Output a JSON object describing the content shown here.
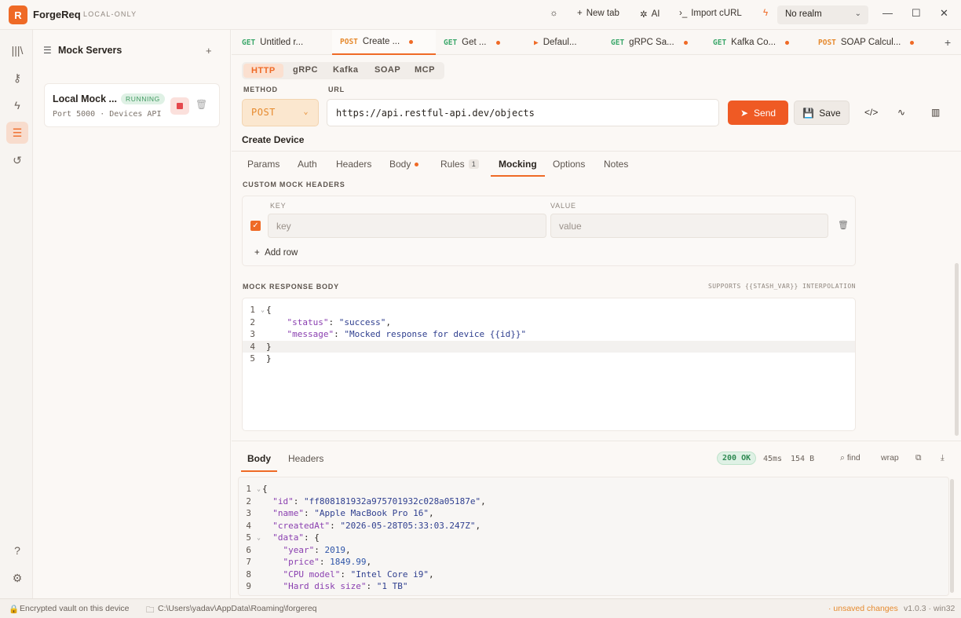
{
  "app": {
    "name": "ForgeReq",
    "badge": "LOCAL-ONLY",
    "logo_letter": "R"
  },
  "toolbar": {
    "theme_icon": "sun-icon",
    "new_tab": "New tab",
    "ai": "AI",
    "import_curl": "Import cURL",
    "realm": "No realm"
  },
  "rail": {
    "icons": [
      "library-icon",
      "key-icon",
      "bolt-icon",
      "server-icon",
      "history-icon",
      "help-icon",
      "gear-icon"
    ]
  },
  "sidebar": {
    "title": "Mock Servers",
    "add": "+",
    "server": {
      "name": "Local Mock ...",
      "status": "RUNNING",
      "sub": "Port 5000 · Devices API"
    }
  },
  "tabs": [
    {
      "method": "GET",
      "label": "Untitled r...",
      "dirty": false
    },
    {
      "method": "POST",
      "label": "Create ...",
      "dirty": true,
      "active": true
    },
    {
      "method": "GET",
      "label": "Get ...",
      "dirty": true
    },
    {
      "method": "▶",
      "label": "Defaul...",
      "dirty": false
    },
    {
      "method": "GET",
      "label": "gRPC Sa...",
      "dirty": true
    },
    {
      "method": "GET",
      "label": "Kafka Co...",
      "dirty": true
    },
    {
      "method": "POST",
      "label": "SOAP Calcul...",
      "dirty": true
    }
  ],
  "protocols": [
    "HTTP",
    "gRPC",
    "Kafka",
    "SOAP",
    "MCP"
  ],
  "request": {
    "method_label": "METHOD",
    "url_label": "URL",
    "method": "POST",
    "url": "https://api.restful-api.dev/objects",
    "send": "Send",
    "save": "Save",
    "name": "Create Device"
  },
  "subtabs": {
    "params": "Params",
    "auth": "Auth",
    "headers": "Headers",
    "body": "Body",
    "rules": "Rules",
    "rules_count": "1",
    "mocking": "Mocking",
    "options": "Options",
    "notes": "Notes"
  },
  "mock": {
    "headers_title": "CUSTOM MOCK HEADERS",
    "key_col": "KEY",
    "value_col": "VALUE",
    "key_placeholder": "key",
    "value_placeholder": "value",
    "add_row": "Add row",
    "body_title": "MOCK RESPONSE BODY",
    "body_hint": "SUPPORTS {{STASH_VAR}} INTERPOLATION",
    "body_lines": [
      "{",
      "    \"status\": \"success\",",
      "    \"message\": \"Mocked response for device {{id}}\"",
      "}",
      "}"
    ]
  },
  "response": {
    "tab_body": "Body",
    "tab_headers": "Headers",
    "status": "200 OK",
    "time": "45ms",
    "size": "154 B",
    "find": "find",
    "wrap": "wrap",
    "lines": [
      "{",
      "  \"id\": \"ff808181932a975701932c028a05187e\",",
      "  \"name\": \"Apple MacBook Pro 16\",",
      "  \"createdAt\": \"2026-05-28T05:33:03.247Z\",",
      "  \"data\": {",
      "    \"year\": 2019,",
      "    \"price\": 1849.99,",
      "    \"CPU model\": \"Intel Core i9\",",
      "    \"Hard disk size\": \"1 TB\""
    ]
  },
  "statusbar": {
    "vault": "Encrypted vault on this device",
    "path": "C:\\Users\\yadav\\AppData\\Roaming\\forgereq",
    "unsaved": "· unsaved changes",
    "version": "v1.0.3 · win32"
  }
}
